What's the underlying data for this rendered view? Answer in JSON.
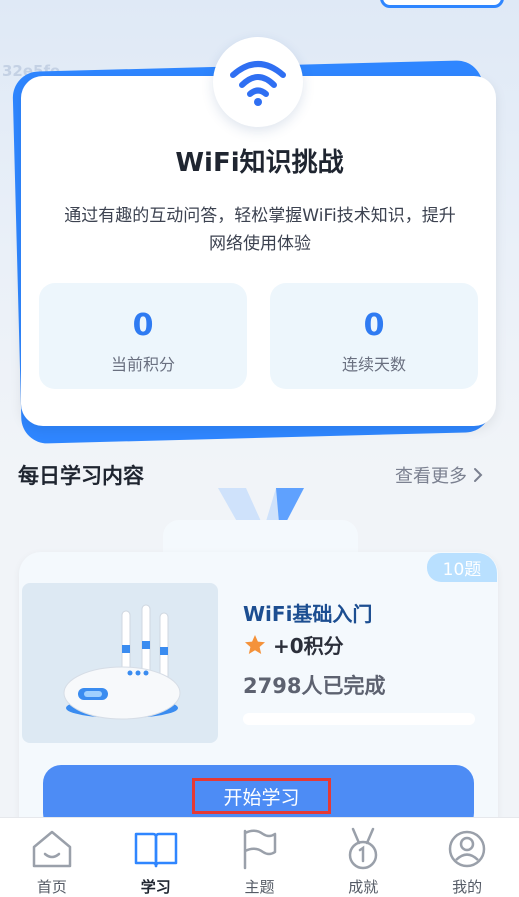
{
  "watermark": "32e5fe",
  "background_text": "WiFi",
  "hero": {
    "title": "WiFi知识挑战",
    "description": "通过有趣的互动问答，轻松掌握WiFi技术知识，提升网络使用体验",
    "stats": [
      {
        "value": "0",
        "label": "当前积分"
      },
      {
        "value": "0",
        "label": "连续天数"
      }
    ]
  },
  "daily": {
    "title": "每日学习内容",
    "more_label": "查看更多",
    "course": {
      "count_badge": "10题",
      "name": "WiFi基础入门",
      "points": "+0积分",
      "completed": "2798人已完成",
      "progress": 0,
      "start_label": "开始学习"
    }
  },
  "tabbar": {
    "items": [
      {
        "label": "首页",
        "icon": "home-icon"
      },
      {
        "label": "学习",
        "icon": "book-icon",
        "active": true
      },
      {
        "label": "主题",
        "icon": "flag-icon"
      },
      {
        "label": "成就",
        "icon": "medal-icon"
      },
      {
        "label": "我的",
        "icon": "user-icon"
      }
    ]
  },
  "colors": {
    "accent": "#2f86ff",
    "button": "#4d8cf5",
    "stat_value": "#2f7bf2",
    "highlight_border": "#e53935",
    "star": "#f4923a"
  }
}
